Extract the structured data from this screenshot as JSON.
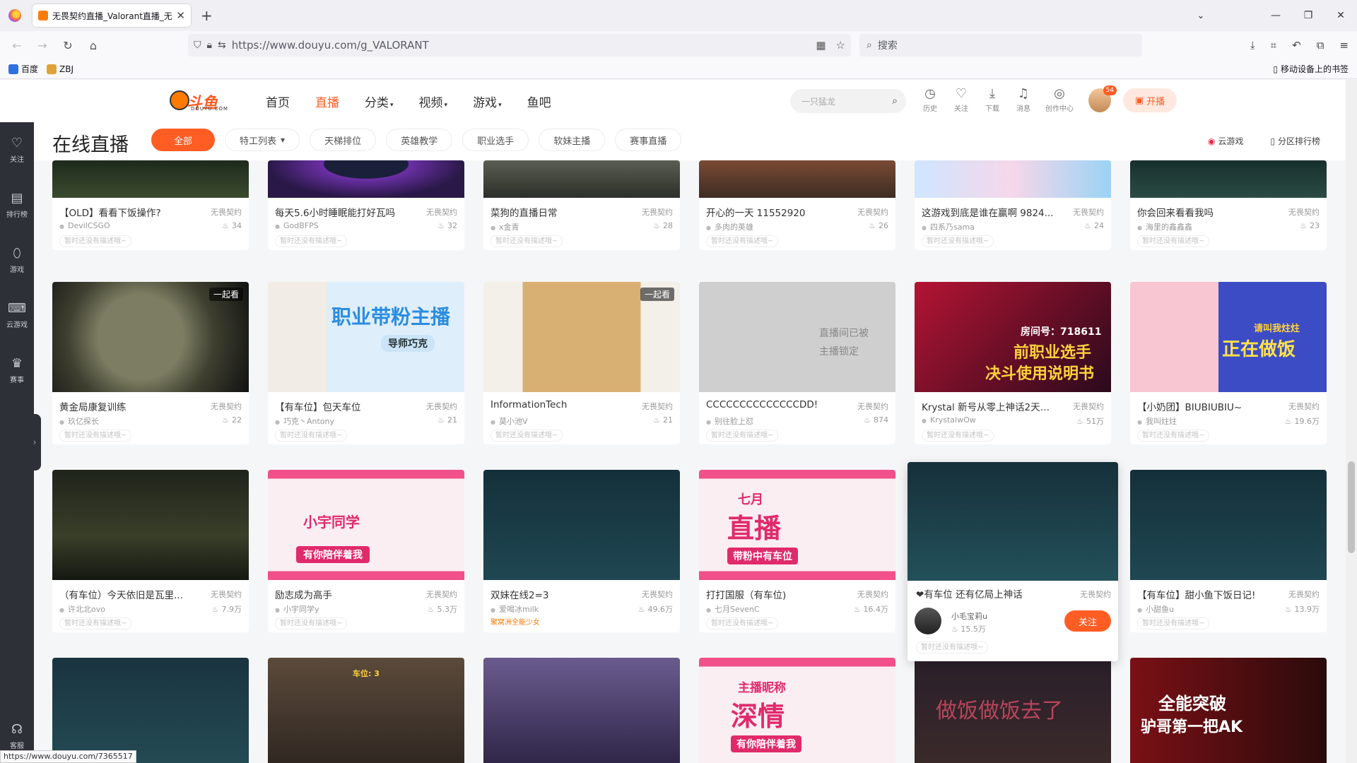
{
  "browser": {
    "tab_title": "无畏契约直播_Valorant直播_无",
    "url": "https://www.douyu.com/g_VALORANT",
    "search_placeholder": "搜索",
    "bookmarks": [
      "百度",
      "ZBJ"
    ],
    "bookmarks_right": "移动设备上的书签",
    "status_url": "https://www.douyu.com/7365517"
  },
  "site": {
    "logo_text": "斗鱼",
    "logo_sub": "DOUYU.COM",
    "nav": [
      {
        "label": "首页"
      },
      {
        "label": "直播"
      },
      {
        "label": "分类"
      },
      {
        "label": "视频"
      },
      {
        "label": "游戏"
      },
      {
        "label": "鱼吧"
      }
    ],
    "search_placeholder": "一只猛龙",
    "tools": [
      {
        "label": "历史",
        "icon": "history-icon"
      },
      {
        "label": "关注",
        "icon": "heart-icon"
      },
      {
        "label": "下载",
        "icon": "download-icon"
      },
      {
        "label": "消息",
        "icon": "bell-icon"
      },
      {
        "label": "创作中心",
        "icon": "creator-icon"
      }
    ],
    "avatar_badge": "54",
    "live_button": "开播"
  },
  "sidebar": [
    {
      "label": "关注",
      "icon": "heart-icon"
    },
    {
      "label": "排行榜",
      "icon": "ranking-icon"
    },
    {
      "label": "游戏",
      "icon": "gamepad-icon"
    },
    {
      "label": "云游戏",
      "icon": "cloud-game-icon"
    },
    {
      "label": "赛事",
      "icon": "trophy-icon"
    }
  ],
  "sidebar_bottom": {
    "label": "客服",
    "icon": "headset-icon"
  },
  "filter": {
    "title": "在线直播",
    "chips": [
      "全部",
      "特工列表",
      "天梯排位",
      "英雄教学",
      "职业选手",
      "软妹主播",
      "赛事直播"
    ],
    "right_links": [
      "云游戏",
      "分区排行榜"
    ]
  },
  "cards": [
    {
      "title": "【OLD】看看下饭操作?",
      "category": "无畏契约",
      "anchor": "DevilCSGO",
      "heat": "34",
      "desc": "暂时还没有描述哦~"
    },
    {
      "title": "每天5.6小时睡眠能打好瓦吗",
      "category": "无畏契约",
      "anchor": "GodBFPS",
      "heat": "32",
      "desc": "暂时还没有描述哦~"
    },
    {
      "title": "菜狗的直播日常",
      "category": "无畏契约",
      "anchor": "x金青",
      "heat": "28",
      "desc": "暂时还没有描述哦~"
    },
    {
      "title": "开心的一天 11552920",
      "category": "无畏契约",
      "anchor": "多肉的英雄",
      "heat": "26",
      "desc": "暂时还没有描述哦~"
    },
    {
      "title": "这游戏到底是谁在赢啊 9824...",
      "category": "无畏契约",
      "anchor": "四系乃sama",
      "heat": "24",
      "desc": "暂时还没有描述哦~"
    },
    {
      "title": "你会回来看看我吗",
      "category": "无畏契约",
      "anchor": "海里的鑫鑫鑫",
      "heat": "23",
      "desc": "暂时还没有描述哦~"
    },
    {
      "title": "黄金局康复训练",
      "category": "无畏契约",
      "anchor": "玖亿探长",
      "heat": "22",
      "desc": "暂时还没有描述哦~",
      "tag": "一起看"
    },
    {
      "title": "【有车位】包天车位",
      "category": "无畏契约",
      "anchor": "巧克丶Antony",
      "heat": "21",
      "desc": "暂时还没有描述哦~",
      "overlay": "职业带粉主播",
      "overlay2": "导师巧克"
    },
    {
      "title": "InformationTech",
      "category": "无畏契约",
      "anchor": "莫小池V",
      "heat": "21",
      "desc": "暂时还没有描述哦~",
      "tag": "一起看"
    },
    {
      "title": "CCCCCCCCCCCCCCDD!",
      "category": "无畏契约",
      "anchor": "别往脸上怼",
      "heat": "874",
      "desc": "暂时还没有描述哦~",
      "locked": [
        "直播间已被",
        "主播锁定"
      ]
    },
    {
      "title": "Krystal 新号从零上神话2天已...",
      "category": "无畏契约",
      "anchor": "KrystalwOw",
      "heat": "51万",
      "desc": "暂时还没有描述哦~",
      "overlay": "房间号：718611",
      "overlay2": "前职业选手",
      "overlay3": "决斗使用说明书"
    },
    {
      "title": "【小奶团】BIUBIUBIU~",
      "category": "无畏契约",
      "anchor": "我叫炷炷",
      "heat": "19.6万",
      "desc": "暂时还没有描述哦~",
      "overlay": "请叫我炷炷",
      "overlay2": "正在做饭"
    },
    {
      "title": "（有车位）今天依旧是瓦里...",
      "category": "无畏契约",
      "anchor": "许北北ovo",
      "heat": "7.9万",
      "desc": "暂时还没有描述哦~"
    },
    {
      "title": "励志成为高手",
      "category": "无畏契约",
      "anchor": "小宇同学y",
      "heat": "5.3万",
      "desc": "暂时还没有描述哦~",
      "overlay": "小宇同学",
      "overlay2": "有你陪伴着我"
    },
    {
      "title": "双妹在线2=3",
      "category": "无畏契约",
      "anchor": "爱喝冰milk",
      "heat": "49.6万",
      "desc": "聚窝洲全能少女"
    },
    {
      "title": "打打国服（有车位)",
      "category": "无畏契约",
      "anchor": "七月SevenC",
      "heat": "16.4万",
      "desc": "暂时还没有描述哦~",
      "overlay": "七月",
      "overlay2": "直播",
      "overlay3": "带粉中有车位"
    },
    {
      "title": "❤有车位 还有亿局上神话",
      "category": "无畏契约",
      "anchor": "小毛宝莉u",
      "heat": "15.5万",
      "desc": "暂时还没有描述哦~",
      "follow": "关注"
    },
    {
      "title": "【有车位】甜小鱼下饭日记!",
      "category": "无畏契约",
      "anchor": "小甜鱼u",
      "heat": "13.9万",
      "desc": "暂时还没有描述哦~"
    },
    {
      "title": "",
      "overlay": "车位: 3"
    },
    {
      "title": "",
      "overlay": "主播昵称",
      "overlay2": "深情",
      "overlay3": "有你陪伴着我"
    },
    {
      "title": "",
      "overlay": "做饭做饭去了"
    },
    {
      "title": "",
      "overlay": "全能突破",
      "overlay2": "驴哥第一把AK"
    }
  ]
}
